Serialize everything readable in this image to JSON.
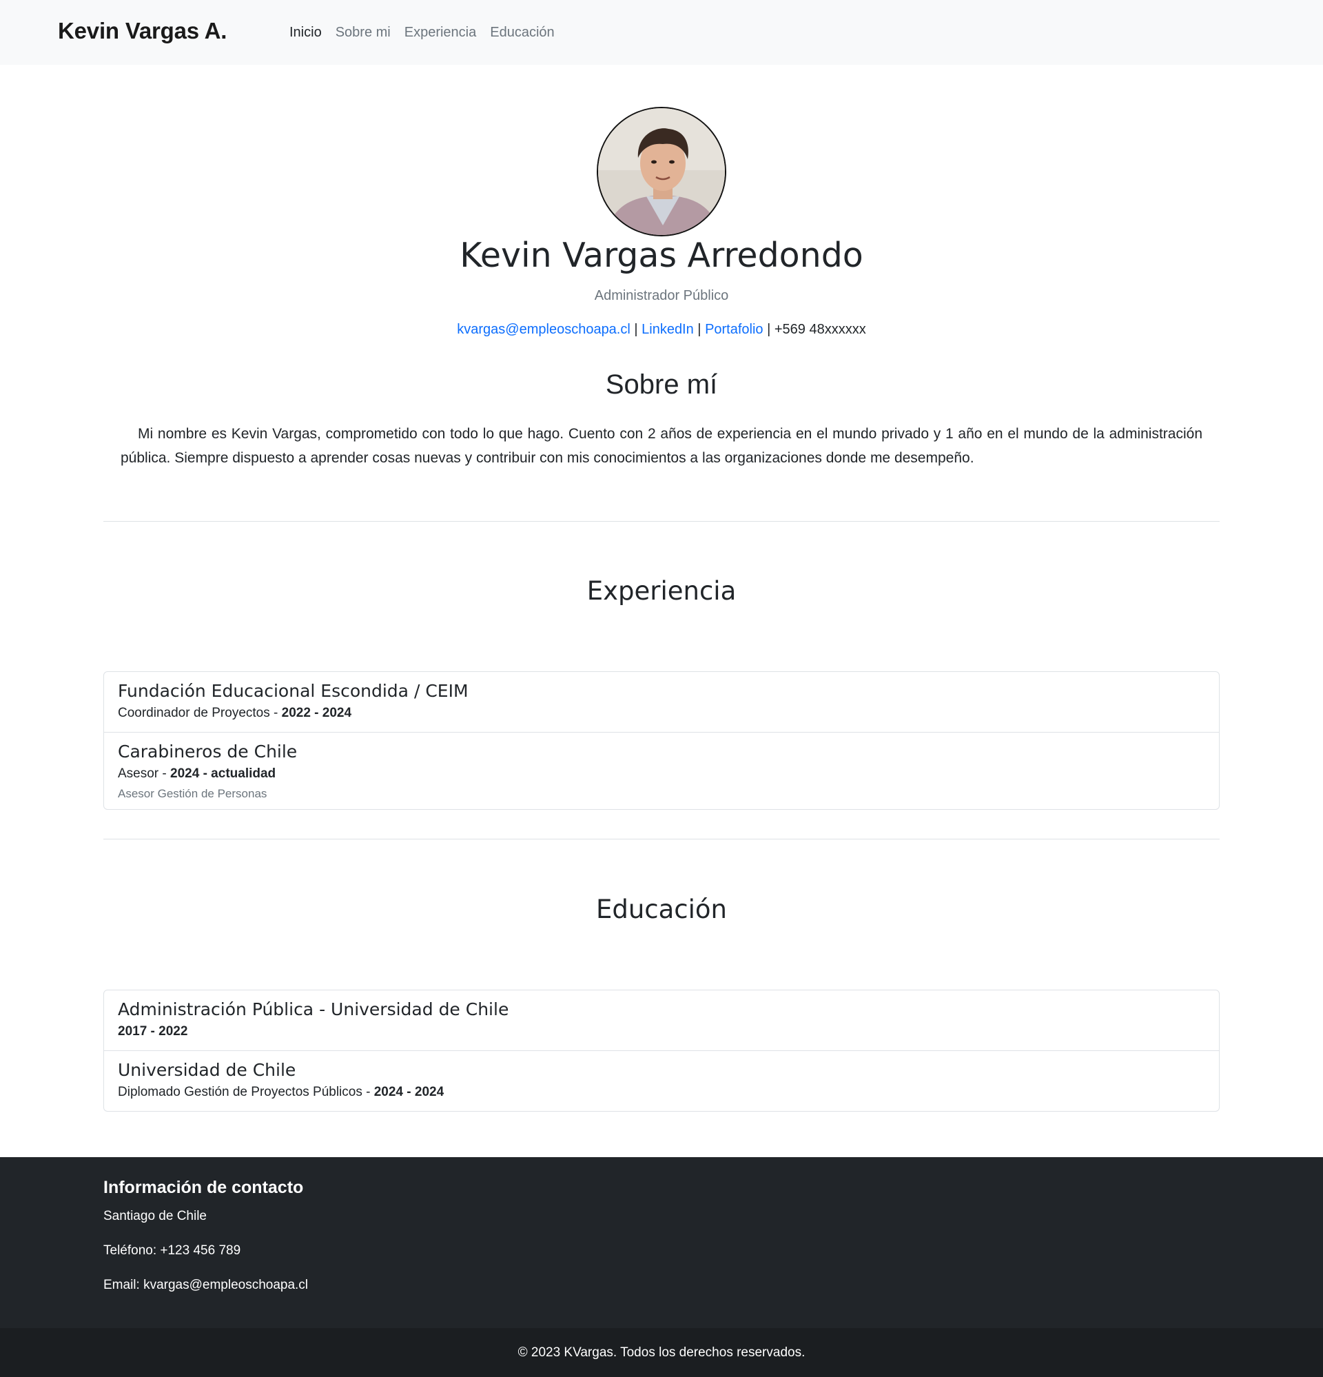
{
  "navbar": {
    "brand": "Kevin Vargas A.",
    "links": [
      "Inicio",
      "Sobre mi",
      "Experiencia",
      "Educación"
    ]
  },
  "hero": {
    "name": "Kevin Vargas Arredondo",
    "role": "Administrador Público",
    "email": "kvargas@empleoschoapa.cl",
    "sep1": " | ",
    "linkedin": "LinkedIn",
    "sep2": " | ",
    "portfolio": "Portafolio",
    "phone": " | +569 48xxxxxx"
  },
  "about": {
    "title": "Sobre mí",
    "text": "Mi nombre es Kevin Vargas, comprometido con todo lo que hago. Cuento con 2 años de experiencia en el mundo privado y 1 año en el mundo de la administración pública. Siempre dispuesto a aprender cosas nuevas y contribuir con mis conocimientos a las organizaciones donde me desempeño."
  },
  "experience": {
    "title": "Experiencia",
    "items": [
      {
        "title": "Fundación Educacional Escondida / CEIM",
        "role": "Coordinador de Proyectos - ",
        "period": "2022 - 2024"
      },
      {
        "title": "Carabineros de Chile",
        "role": "Asesor - ",
        "period": "2024 - actualidad",
        "note": "Asesor Gestión de Personas"
      }
    ]
  },
  "education": {
    "title": "Educación",
    "items": [
      {
        "title": "Administración Pública - Universidad de Chile",
        "period": "2017 - 2022"
      },
      {
        "title": "Universidad de Chile",
        "role": "Diplomado Gestión de Proyectos Públicos - ",
        "period": "2024 - 2024"
      }
    ]
  },
  "footer": {
    "title": "Información de contacto",
    "city": "Santiago de Chile",
    "phone": "Teléfono: +123 456 789",
    "email": "Email: kvargas@empleoschoapa.cl",
    "copyright": "© 2023 KVargas. Todos los derechos reservados."
  }
}
